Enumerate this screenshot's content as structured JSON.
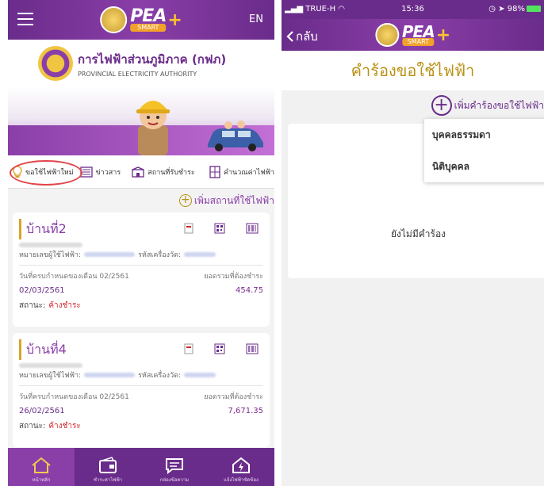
{
  "left": {
    "header": {
      "logo_text": "PEA",
      "logo_sub": "SMART",
      "lang": "EN"
    },
    "brand": {
      "thai": "การไฟฟ้าส่วนภูมิภาค (กฟภ)",
      "english": "PROVINCIAL ELECTRICITY AUTHORITY"
    },
    "menu": [
      {
        "label": "ขอใช้ไฟฟ้าใหม่",
        "icon": "lightbulb-icon"
      },
      {
        "label": "ข่าวสาร",
        "icon": "newspaper-icon"
      },
      {
        "label": "สถานที่รับชำระ",
        "icon": "payment-place-icon"
      },
      {
        "label": "คำนวณค่าไฟฟ้า",
        "icon": "calculator-icon"
      }
    ],
    "add_place_label": "เพิ่มสถานที่ใช้ไฟฟ้า",
    "cards": [
      {
        "title": "บ้านที่2",
        "account_label": "หมายเลขผู้ใช้ไฟฟ้า:",
        "meter_label": "รหัสเครื่องวัด:",
        "due_label": "วันที่ครบกำหนดของเดือน 02/2561",
        "total_label": "ยอดรวมที่ต้องชำระ",
        "date": "02/03/2561",
        "amount": "454.75",
        "status_label": "สถานะ:",
        "status_value": "ค้างชำระ"
      },
      {
        "title": "บ้านที่4",
        "account_label": "หมายเลขผู้ใช้ไฟฟ้า:",
        "meter_label": "รหัสเครื่องวัด:",
        "due_label": "วันที่ครบกำหนดของเดือน 02/2561",
        "total_label": "ยอดรวมที่ต้องชำระ",
        "date": "26/02/2561",
        "amount": "7,671.35",
        "status_label": "สถานะ:",
        "status_value": "ค้างชำระ"
      }
    ],
    "bottom_nav": [
      {
        "label": "หน้าหลัก",
        "icon": "home-icon"
      },
      {
        "label": "ชำระค่าไฟฟ้า",
        "icon": "wallet-icon"
      },
      {
        "label": "กล่องข้อความ",
        "icon": "message-icon"
      },
      {
        "label": "แจ้งไฟฟ้าขัดข้อง",
        "icon": "outage-icon"
      }
    ]
  },
  "right": {
    "status_bar": {
      "carrier": "TRUE-H",
      "time": "15:36",
      "battery": "98%"
    },
    "nav": {
      "back_label": "กลับ",
      "logo_text": "PEA",
      "logo_sub": "SMART"
    },
    "title": "คำร้องขอใช้ไฟฟ้า",
    "add_request_label": "เพิ่มคำร้องขอใช้ไฟฟ้า",
    "dropdown_options": [
      "บุคคลธรรมดา",
      "นิติบุคคล"
    ],
    "empty_text": "ยังไม่มีคำร้อง"
  },
  "colors": {
    "primary": "#6a2c8a",
    "gold": "#b99216",
    "alert": "#d0262d"
  }
}
